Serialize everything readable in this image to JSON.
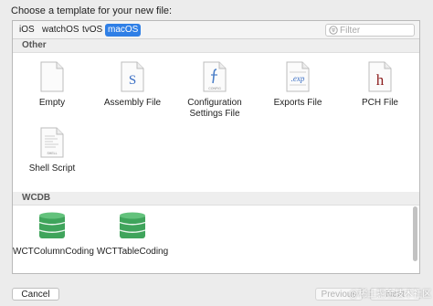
{
  "dialog": {
    "title": "Choose a template for your new file:"
  },
  "tabs": [
    {
      "label": "iOS",
      "selected": false
    },
    {
      "label": "watchOS",
      "selected": false
    },
    {
      "label": "tvOS",
      "selected": false
    },
    {
      "label": "macOS",
      "selected": true
    }
  ],
  "filter": {
    "placeholder": "Filter",
    "value": "",
    "icon": "filter-icon"
  },
  "sections": [
    {
      "header": "Other",
      "items": [
        {
          "label": "Empty",
          "icon": "blank-document-icon"
        },
        {
          "label": "Assembly File",
          "icon": "assembly-file-icon",
          "glyph": "S"
        },
        {
          "label": "Configuration Settings File",
          "icon": "config-file-icon",
          "glyph": "CONFIG"
        },
        {
          "label": "Exports File",
          "icon": "exports-file-icon",
          "glyph": ".exp"
        },
        {
          "label": "PCH File",
          "icon": "pch-file-icon",
          "glyph": "h"
        },
        {
          "label": "Shell Script",
          "icon": "shell-script-icon",
          "glyph": "SHELL"
        }
      ]
    },
    {
      "header": "WCDB",
      "items": [
        {
          "label": "WCTColumnCoding",
          "icon": "database-icon"
        },
        {
          "label": "WCTTableCoding",
          "icon": "database-icon"
        }
      ]
    }
  ],
  "buttons": {
    "cancel": "Cancel",
    "previous": "Previous",
    "next": "Next"
  },
  "watermark": "@稀土掘金技术社区",
  "colors": {
    "accent": "#2f7fe6",
    "database": "#3fa45b",
    "pch": "#8b1c1c"
  }
}
